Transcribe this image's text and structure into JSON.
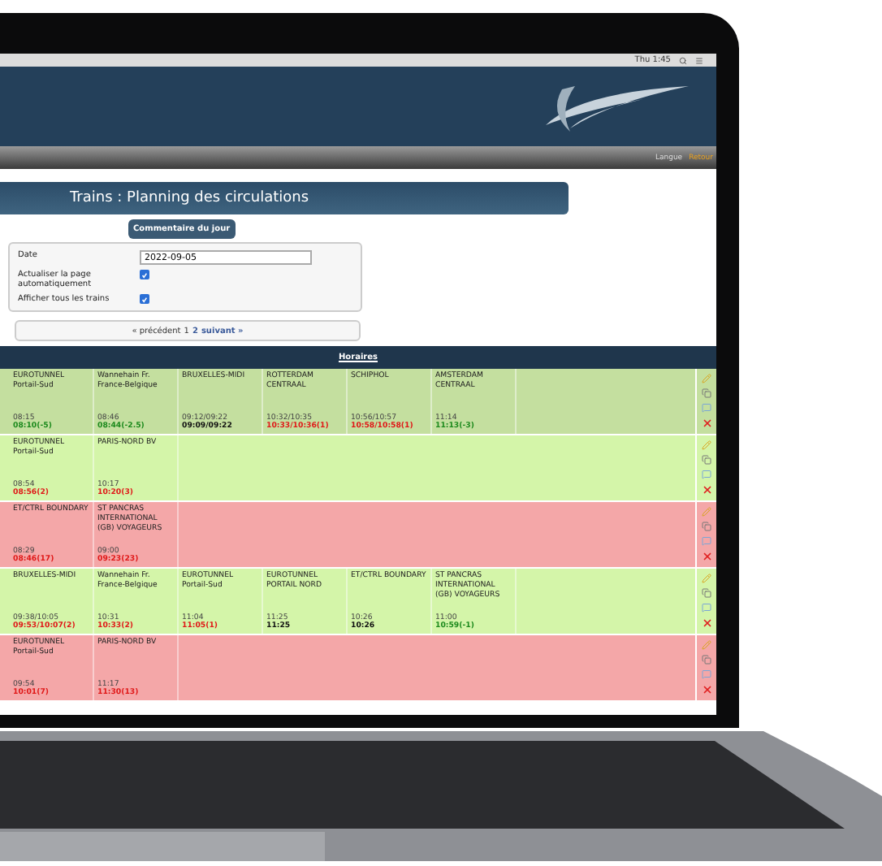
{
  "menu_bar": {
    "clock": "Thu 1:45"
  },
  "nav": {
    "language": "Langue",
    "link": "Retour"
  },
  "title": "Trains : Planning des circulations",
  "comment_button": "Commentaire du jour",
  "form": {
    "date_label": "Date",
    "date_value": "2022-09-05",
    "options": [
      {
        "label": "Actualiser la page automatiquement",
        "checked": true
      },
      {
        "label": "Afficher tous les trains",
        "checked": true
      }
    ]
  },
  "pager": {
    "prev": "« précédent",
    "pages": [
      {
        "label": "1",
        "selected": true
      },
      {
        "label": "2",
        "selected": false
      }
    ],
    "next": "suivant »"
  },
  "table": {
    "header": "Horaires",
    "rows": [
      {
        "color": "#c4df9f",
        "stops": [
          {
            "name": "EUROTUNNEL Portail-Sud",
            "planned": "08:15",
            "actual": "08:10(-5)",
            "kind": "early"
          },
          {
            "name": "Wannehain Fr. France-Belgique",
            "planned": "08:46",
            "actual": "08:44(-2.5)",
            "kind": "early"
          },
          {
            "name": "BRUXELLES-MIDI",
            "planned": "09:12/09:22",
            "actual": "09:09/09:22",
            "kind": "on_time"
          },
          {
            "name": "ROTTERDAM CENTRAAL",
            "planned": "10:32/10:35",
            "actual": "10:33/10:36(1)",
            "kind": "late"
          },
          {
            "name": "SCHIPHOL",
            "planned": "10:56/10:57",
            "actual": "10:58/10:58(1)",
            "kind": "late"
          },
          {
            "name": "AMSTERDAM CENTRAAL",
            "planned": "11:14",
            "actual": "11:13(-3)",
            "kind": "early"
          }
        ]
      },
      {
        "color": "#d4f5a9",
        "stops": [
          {
            "name": "EUROTUNNEL Portail-Sud",
            "planned": "08:54",
            "actual": "08:56(2)",
            "kind": "late"
          },
          {
            "name": "PARIS-NORD BV",
            "planned": "10:17",
            "actual": "10:20(3)",
            "kind": "late"
          }
        ]
      },
      {
        "color": "#f4a7a8",
        "stops": [
          {
            "name": "ET/CTRL BOUNDARY",
            "planned": "08:29",
            "actual": "08:46(17)",
            "kind": "late"
          },
          {
            "name": "ST PANCRAS INTERNATIONAL (GB) VOYAGEURS",
            "planned": "09:00",
            "actual": "09:23(23)",
            "kind": "late"
          }
        ]
      },
      {
        "color": "#d4f5a9",
        "stops": [
          {
            "name": "BRUXELLES-MIDI",
            "planned": "09:38/10:05",
            "actual": "09:53/10:07(2)",
            "kind": "late"
          },
          {
            "name": "Wannehain Fr. France-Belgique",
            "planned": "10:31",
            "actual": "10:33(2)",
            "kind": "late"
          },
          {
            "name": "EUROTUNNEL Portail-Sud",
            "planned": "11:04",
            "actual": "11:05(1)",
            "kind": "late"
          },
          {
            "name": "EUROTUNNEL PORTAIL NORD",
            "planned": "11:25",
            "actual": "11:25",
            "kind": "on_time"
          },
          {
            "name": "ET/CTRL BOUNDARY",
            "planned": "10:26",
            "actual": "10:26",
            "kind": "on_time"
          },
          {
            "name": "ST PANCRAS INTERNATIONAL (GB) VOYAGEURS",
            "planned": "11:00",
            "actual": "10:59(-1)",
            "kind": "early"
          }
        ]
      },
      {
        "color": "#f4a7a8",
        "stops": [
          {
            "name": "EUROTUNNEL Portail-Sud",
            "planned": "09:54",
            "actual": "10:01(7)",
            "kind": "late"
          },
          {
            "name": "PARIS-NORD BV",
            "planned": "11:17",
            "actual": "11:30(13)",
            "kind": "late"
          }
        ]
      }
    ]
  }
}
